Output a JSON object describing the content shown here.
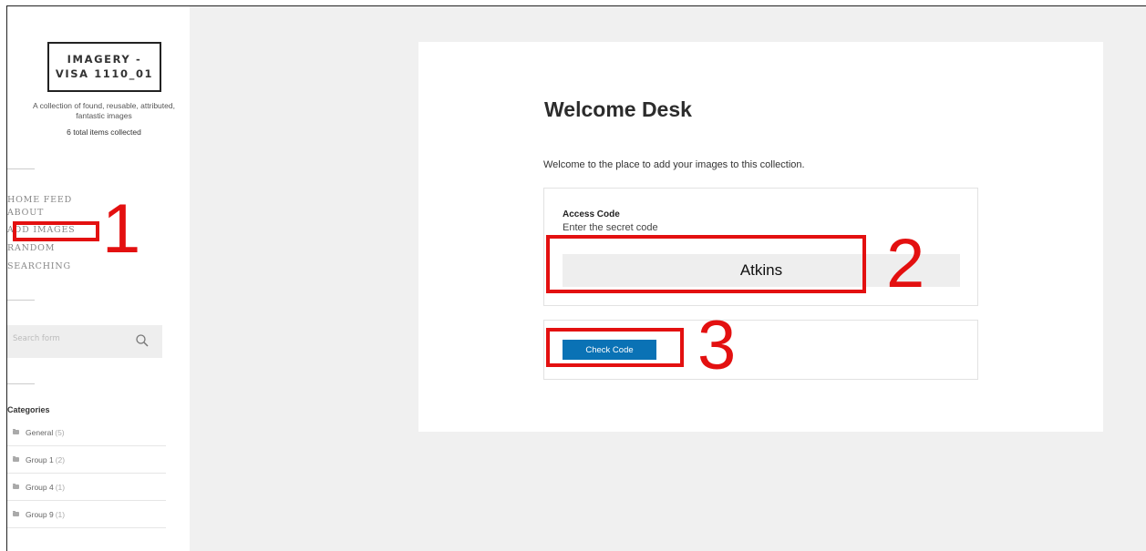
{
  "site": {
    "title": "IMAGERY - VISA 1110_01",
    "tagline": "A collection of found, reusable, attributed, fantastic images",
    "item_count": "6 total items collected"
  },
  "nav": {
    "items": [
      {
        "label": "HOME FEED"
      },
      {
        "label": "ABOUT"
      },
      {
        "label": "ADD IMAGES"
      },
      {
        "label": "RANDOM"
      },
      {
        "label": "SEARCHING"
      }
    ]
  },
  "search": {
    "placeholder": "Search form",
    "icon": "search-icon"
  },
  "categories": {
    "title": "Categories",
    "items": [
      {
        "name": "General",
        "count": "(5)"
      },
      {
        "name": "Group 1",
        "count": "(2)"
      },
      {
        "name": "Group 4",
        "count": "(1)"
      },
      {
        "name": "Group 9",
        "count": "(1)"
      }
    ]
  },
  "main": {
    "heading": "Welcome Desk",
    "intro": "Welcome to the place to add your images to this collection.",
    "access_code": {
      "label": "Access Code",
      "description": "Enter the secret code",
      "value": "Atkins"
    },
    "button_label": "Check Code"
  },
  "annotations": {
    "color": "#e31010",
    "labels": [
      "1",
      "2",
      "3"
    ]
  },
  "colors": {
    "button": "#0a72b5",
    "background": "#f0f0f0"
  }
}
